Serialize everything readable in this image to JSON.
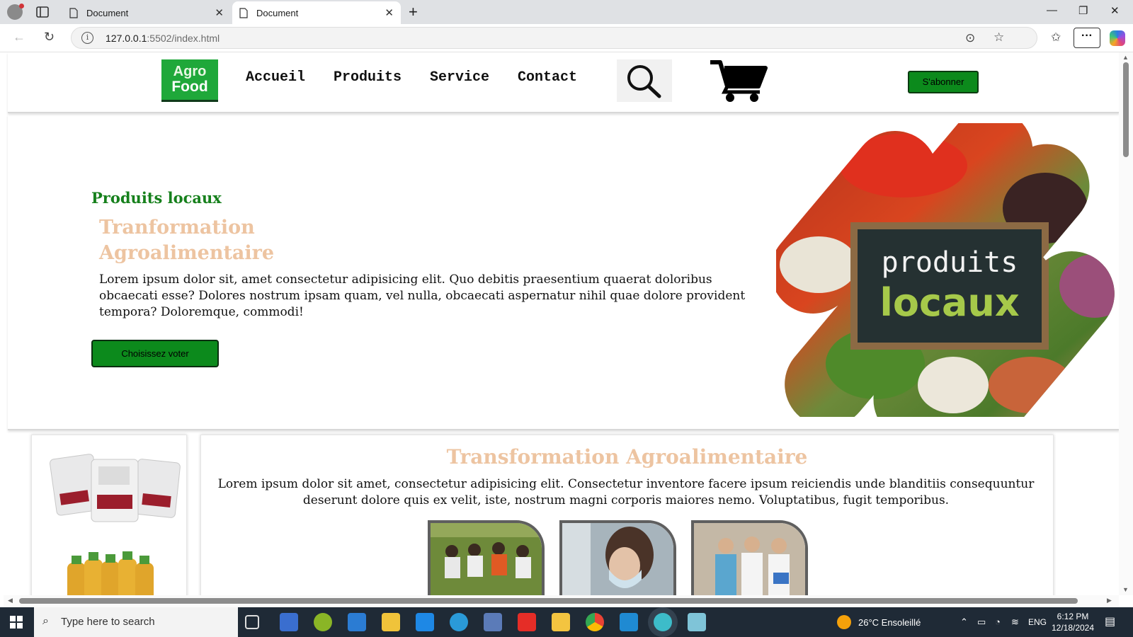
{
  "browser": {
    "tabs": [
      {
        "title": "Document",
        "active": false
      },
      {
        "title": "Document",
        "active": true
      }
    ],
    "url_host": "127.0.0.1",
    "url_path": ":5502/index.html"
  },
  "site": {
    "logo": {
      "line1": "Agro",
      "line2": "Food"
    },
    "nav": [
      "Accueil",
      "Produits",
      "Service",
      "Contact"
    ],
    "subscribe_label": "S'abonner",
    "hero": {
      "kicker": "Produits locaux",
      "title_line1": "Tranformation",
      "title_line2": "Agroalimentaire",
      "text": "Lorem ipsum dolor sit, amet consectetur adipisicing elit. Quo debitis praesentium quaerat doloribus obcaecati esse? Dolores nostrum ipsam quam, vel nulla, obcaecati aspernatur nihil quae dolore provident tempora? Doloremque, commodi!",
      "button_label": "Choisissez voter",
      "image_text_line1": "produits",
      "image_text_line2": "locaux"
    },
    "section": {
      "title": "Transformation Agroalimentaire",
      "text": "Lorem ipsum dolor sit amet, consectetur adipisicing elit. Consectetur inventore facere ipsum reiciendis unde blanditiis consequuntur deserunt dolore quis ex velit, iste, nostrum magni corporis maiores nemo. Voluptatibus, fugit temporibus."
    }
  },
  "taskbar": {
    "search_placeholder": "Type here to search",
    "weather": "26°C Ensoleillé",
    "language": "ENG",
    "time": "6:12 PM",
    "date": "12/18/2024"
  },
  "colors": {
    "accent_green": "#0c8a1c",
    "kicker_green": "#16801c",
    "title_peach": "#edc4a1"
  }
}
